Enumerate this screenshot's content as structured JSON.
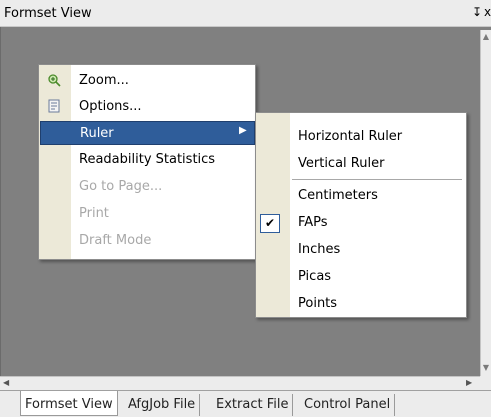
{
  "window": {
    "title": "Formset View",
    "pin_glyph": "↧",
    "close_glyph": "x"
  },
  "context_menu": {
    "items": [
      {
        "label": "Zoom...",
        "icon": "zoom-icon",
        "disabled": false
      },
      {
        "label": "Options...",
        "icon": "options-icon",
        "disabled": false
      },
      {
        "label": "Ruler",
        "icon": "",
        "disabled": false,
        "selected": true,
        "has_submenu": true
      },
      {
        "label": "Readability Statistics",
        "icon": "",
        "disabled": false
      },
      {
        "label": "Go to Page...",
        "icon": "",
        "disabled": true
      },
      {
        "label": "Print",
        "icon": "",
        "disabled": true
      },
      {
        "label": "Draft Mode",
        "icon": "",
        "disabled": true
      }
    ],
    "submenu_arrow": "▶"
  },
  "ruler_submenu": {
    "items": [
      {
        "label": "Horizontal Ruler",
        "checked": false
      },
      {
        "label": "Vertical Ruler",
        "checked": false
      },
      {
        "label": "Centimeters",
        "checked": false
      },
      {
        "label": "FAPs",
        "checked": true
      },
      {
        "label": "Inches",
        "checked": false
      },
      {
        "label": "Picas",
        "checked": false
      },
      {
        "label": "Points",
        "checked": false
      }
    ],
    "check_glyph": "✔"
  },
  "tabs": [
    {
      "label": "Formset View",
      "active": true
    },
    {
      "label": "AfgJob File",
      "active": false
    },
    {
      "label": "Extract File",
      "active": false
    },
    {
      "label": "Control Panel",
      "active": false
    }
  ],
  "scroll_glyphs": {
    "up": "▲",
    "down": "▼",
    "left": "◀",
    "right": "▶"
  },
  "colors": {
    "selection": "#2f5d9a",
    "client_background": "#808080"
  }
}
